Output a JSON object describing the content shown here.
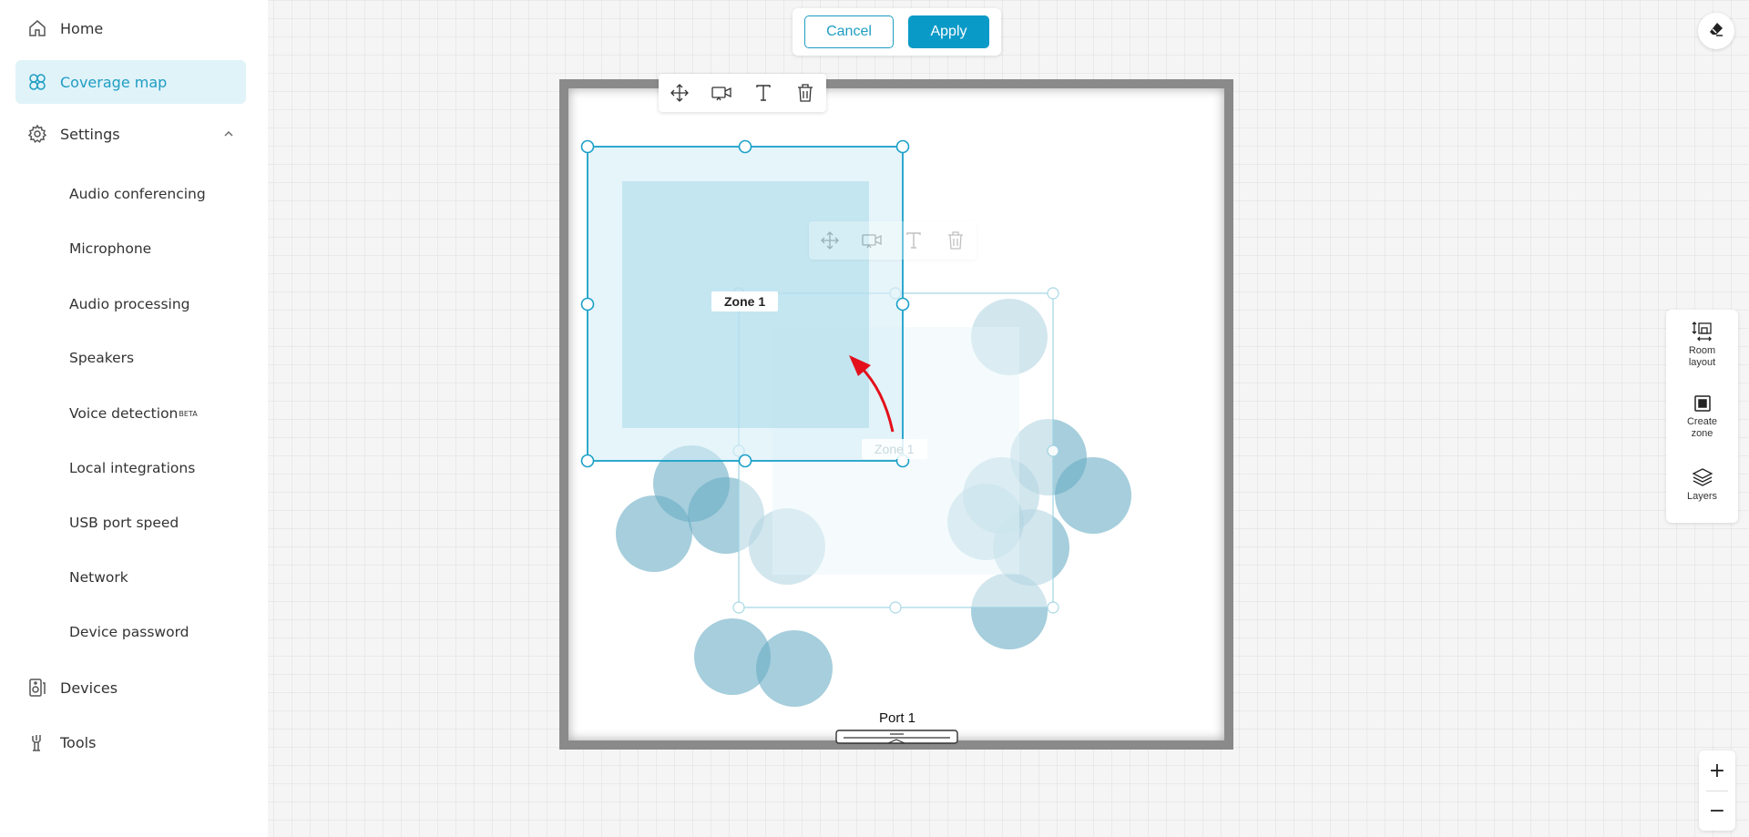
{
  "sidebar": {
    "home": "Home",
    "coverage_map": "Coverage map",
    "settings": "Settings",
    "sub_items": [
      "Audio conferencing",
      "Microphone",
      "Audio processing",
      "Speakers",
      "Voice detection",
      "Local integrations",
      "USB port speed",
      "Network",
      "Device password"
    ],
    "beta_tag": "BETA",
    "devices": "Devices",
    "tools": "Tools"
  },
  "actions": {
    "cancel": "Cancel",
    "apply": "Apply"
  },
  "tools": {
    "room_layout": [
      "Room",
      "layout"
    ],
    "create_zone": [
      "Create",
      "zone"
    ],
    "layers": "Layers"
  },
  "zoom": {
    "in": "+",
    "out": "−"
  },
  "canvas": {
    "zone_label": "Zone 1",
    "ghost_zone_label": "Zone 1",
    "port_label": "Port 1"
  },
  "icons": [
    "home-icon",
    "coverage-map-icon",
    "gear-icon",
    "chevron-up-icon",
    "devices-icon",
    "tools-icon",
    "eraser-icon",
    "room-layout-icon",
    "create-zone-icon",
    "layers-icon",
    "move-icon",
    "camera-icon",
    "text-icon",
    "trash-icon"
  ],
  "colors": {
    "accent": "#0a9ac8",
    "accent_text": "#1e9dc3",
    "active_bg": "#e0f3f9",
    "zone_stroke": "#1aa0c8",
    "coverage": "#6aaec4",
    "arrow": "#e3101b"
  }
}
